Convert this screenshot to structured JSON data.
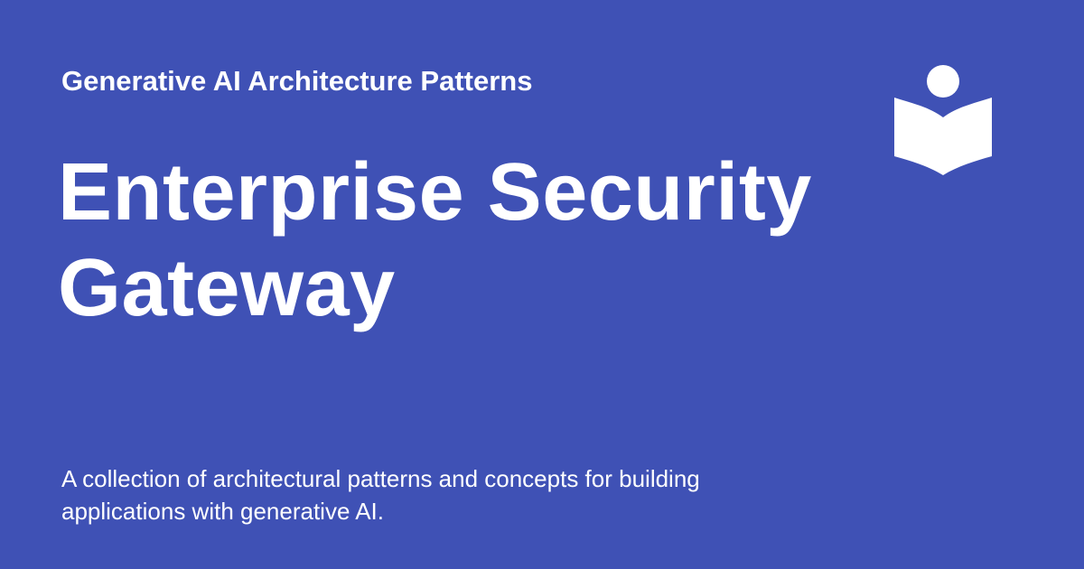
{
  "card": {
    "site_name": "Generative AI Architecture Patterns",
    "title_lines": [
      "Enterprise Security",
      "Gateway"
    ],
    "description": "A collection of architectural patterns and concepts for building applications with generative AI.",
    "logo_icon": "reading-book-icon",
    "colors": {
      "background": "#3f51b5",
      "text": "#ffffff"
    }
  }
}
